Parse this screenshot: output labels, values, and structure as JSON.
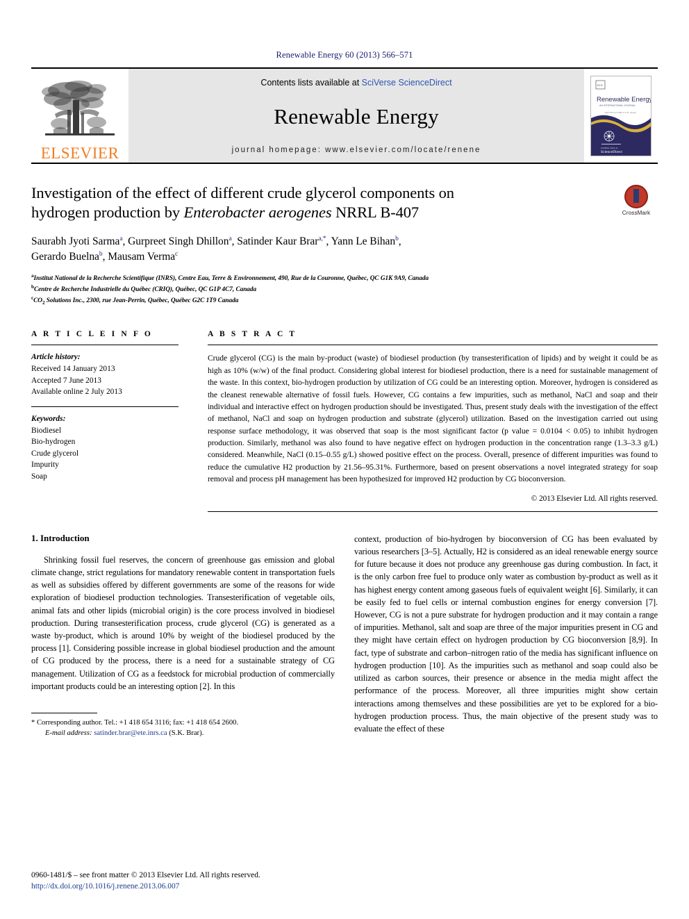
{
  "running_head": "Renewable Energy 60 (2013) 566–571",
  "masthead": {
    "publisher_name": "ELSEVIER",
    "contents_prefix": "Contents lists available at ",
    "contents_link": "SciVerse ScienceDirect",
    "journal_title": "Renewable Energy",
    "homepage": "journal homepage: www.elsevier.com/locate/renene",
    "cover_title": "Renewable Energy",
    "cover_subtitle": "AN INTERNATIONAL JOURNAL",
    "cover_publisher": "ELSEVIER"
  },
  "article": {
    "title_line1": "Investigation of the effect of different crude glycerol components on",
    "title_line2_pre": "hydrogen production by ",
    "title_line2_italic": "Enterobacter aerogenes",
    "title_line2_post": " NRRL B-407",
    "crossmark_label": "CrossMark",
    "authors": "Saurabh Jyoti Sarma a, Gurpreet Singh Dhillon a, Satinder Kaur Brar a,*, Yann Le Bihan b, Gerardo Buelna b, Mausam Verma c",
    "affiliation_a": "Institut National de la Recherche Scientifique (INRS), Centre Eau, Terre & Environnement, 490, Rue de la Couronne, Québec, QC G1K 9A9, Canada",
    "affiliation_b": "Centre de Recherche Industrielle du Québec (CRIQ), Québec, QC G1P 4C7, Canada",
    "affiliation_c": "CO2 Solutions Inc., 2300, rue Jean-Perrin, Québec, Québec G2C 1T9 Canada"
  },
  "article_info": {
    "heading": "A R T I C L E   I N F O",
    "history_label": "Article history:",
    "received": "Received 14 January 2013",
    "accepted": "Accepted 7 June 2013",
    "available": "Available online 2 July 2013",
    "keywords_label": "Keywords:",
    "keywords": [
      "Biodiesel",
      "Bio-hydrogen",
      "Crude glycerol",
      "Impurity",
      "Soap"
    ]
  },
  "abstract": {
    "heading": "A B S T R A C T",
    "text": "Crude glycerol (CG) is the main by-product (waste) of biodiesel production (by transesterification of lipids) and by weight it could be as high as 10% (w/w) of the final product. Considering global interest for biodiesel production, there is a need for sustainable management of the waste. In this context, bio-hydrogen production by utilization of CG could be an interesting option. Moreover, hydrogen is considered as the cleanest renewable alternative of fossil fuels. However, CG contains a few impurities, such as methanol, NaCl and soap and their individual and interactive effect on hydrogen production should be investigated. Thus, present study deals with the investigation of the effect of methanol, NaCl and soap on hydrogen production and substrate (glycerol) utilization. Based on the investigation carried out using response surface methodology, it was observed that soap is the most significant factor (p value = 0.0104 < 0.05) to inhibit hydrogen production. Similarly, methanol was also found to have negative effect on hydrogen production in the concentration range (1.3–3.3 g/L) considered. Meanwhile, NaCl (0.15–0.55 g/L) showed positive effect on the process. Overall, presence of different impurities was found to reduce the cumulative H2 production by 21.56–95.31%. Furthermore, based on present observations a novel integrated strategy for soap removal and process pH management has been hypothesized for improved H2 production by CG bioconversion.",
    "copyright": "© 2013 Elsevier Ltd. All rights reserved."
  },
  "introduction": {
    "heading": "1. Introduction",
    "left_paragraph": "Shrinking fossil fuel reserves, the concern of greenhouse gas emission and global climate change, strict regulations for mandatory renewable content in transportation fuels as well as subsidies offered by different governments are some of the reasons for wide exploration of biodiesel production technologies. Transesterification of vegetable oils, animal fats and other lipids (microbial origin) is the core process involved in biodiesel production. During transesterification process, crude glycerol (CG) is generated as a waste by-product, which is around 10% by weight of the biodiesel produced by the process [1]. Considering possible increase in global biodiesel production and the amount of CG produced by the process, there is a need for a sustainable strategy of CG management. Utilization of CG as a feedstock for microbial production of commercially important products could be an interesting option [2]. In this",
    "right_paragraph": "context, production of bio-hydrogen by bioconversion of CG has been evaluated by various researchers [3–5]. Actually, H2 is considered as an ideal renewable energy source for future because it does not produce any greenhouse gas during combustion. In fact, it is the only carbon free fuel to produce only water as combustion by-product as well as it has highest energy content among gaseous fuels of equivalent weight [6]. Similarly, it can be easily fed to fuel cells or internal combustion engines for energy conversion [7]. However, CG is not a pure substrate for hydrogen production and it may contain a range of impurities. Methanol, salt and soap are three of the major impurities present in CG and they might have certain effect on hydrogen production by CG bioconversion [8,9]. In fact, type of substrate and carbon–nitrogen ratio of the media has significant influence on hydrogen production [10]. As the impurities such as methanol and soap could also be utilized as carbon sources, their presence or absence in the media might affect the performance of the process. Moreover, all three impurities might show certain interactions among themselves and these possibilities are yet to be explored for a bio-hydrogen production process. Thus, the main objective of the present study was to evaluate the effect of these"
  },
  "footnote": {
    "corresponding": "* Corresponding author. Tel.: +1 418 654 3116; fax: +1 418 654 2600.",
    "email_label": "E-mail address:",
    "email": "satinder.brar@ete.inrs.ca",
    "email_owner": "(S.K. Brar)."
  },
  "footer": {
    "issn_line": "0960-1481/$ – see front matter © 2013 Elsevier Ltd. All rights reserved.",
    "doi": "http://dx.doi.org/10.1016/j.renene.2013.06.007"
  },
  "colors": {
    "elsevier_orange": "#F07D21",
    "link_blue": "#2a56b5",
    "ref_blue": "#1b3a8f",
    "running_head_navy": "#1b1b6f",
    "band_grey": "#e6e6e6"
  }
}
